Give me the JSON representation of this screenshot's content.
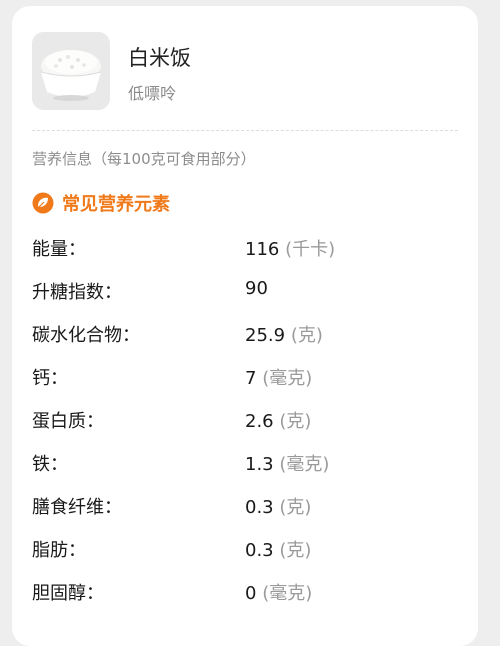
{
  "food": {
    "name": "白米饭",
    "purine_level": "低嘌呤",
    "image_icon": "rice-bowl-icon"
  },
  "section": {
    "caption": "营养信息（每100克可食用部分）",
    "title": "常见营养元素",
    "icon": "leaf-icon",
    "accent_color": "#f07a1a"
  },
  "nutrients": [
    {
      "label": "能量：",
      "value": "116",
      "unit": "(千卡)"
    },
    {
      "label": "升糖指数：",
      "value": "90",
      "unit": ""
    },
    {
      "label": "碳水化合物：",
      "value": "25.9",
      "unit": "(克)"
    },
    {
      "label": "钙：",
      "value": "7",
      "unit": "(毫克)"
    },
    {
      "label": "蛋白质：",
      "value": "2.6",
      "unit": "(克)"
    },
    {
      "label": "铁：",
      "value": "1.3",
      "unit": "(毫克)"
    },
    {
      "label": "膳食纤维：",
      "value": "0.3",
      "unit": "(克)"
    },
    {
      "label": "脂肪：",
      "value": "0.3",
      "unit": "(克)"
    },
    {
      "label": "胆固醇：",
      "value": "0",
      "unit": "(毫克)"
    }
  ]
}
